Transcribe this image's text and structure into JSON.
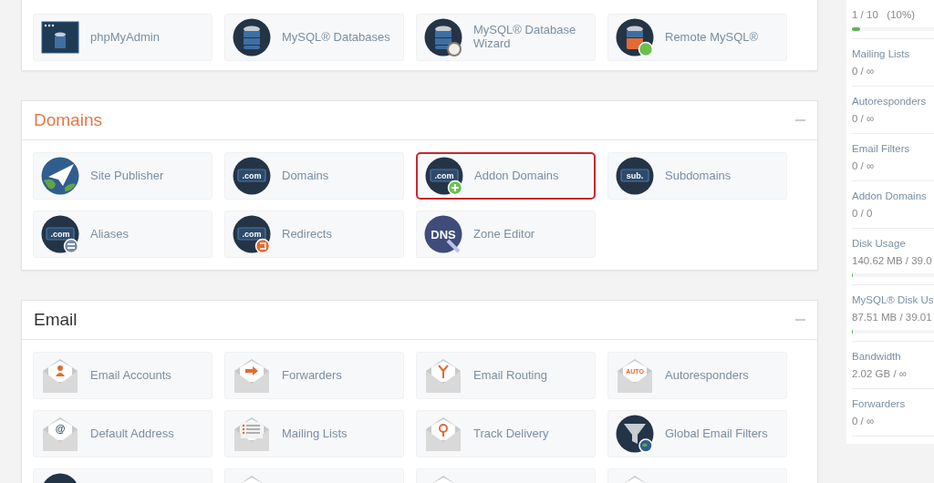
{
  "top_panel": {
    "items": [
      {
        "label": "phpMyAdmin",
        "kind": "db-window",
        "highlighted": false
      },
      {
        "label": "MySQL® Databases",
        "kind": "db",
        "highlighted": false
      },
      {
        "label": "MySQL® Database Wizard",
        "kind": "db-wizard",
        "highlighted": false
      },
      {
        "label": "Remote MySQL®",
        "kind": "db-remote",
        "highlighted": false
      }
    ]
  },
  "sections": [
    {
      "title": "Domains",
      "accent": true,
      "items": [
        {
          "label": "Site Publisher",
          "kind": "globe-plane",
          "highlighted": false
        },
        {
          "label": "Domains",
          "kind": "com",
          "icon_text": ".com",
          "highlighted": false
        },
        {
          "label": "Addon Domains",
          "kind": "com-plus",
          "icon_text": ".com",
          "highlighted": true
        },
        {
          "label": "Subdomains",
          "kind": "com",
          "icon_text": "sub.",
          "highlighted": false
        },
        {
          "label": "Aliases",
          "kind": "com-equal",
          "icon_text": ".com",
          "highlighted": false
        },
        {
          "label": "Redirects",
          "kind": "com-redirect",
          "icon_text": ".com",
          "highlighted": false
        },
        {
          "label": "Zone Editor",
          "kind": "dns",
          "icon_text": "DNS",
          "highlighted": false
        }
      ]
    },
    {
      "title": "Email",
      "accent": false,
      "items": [
        {
          "label": "Email Accounts",
          "kind": "env-person",
          "highlighted": false
        },
        {
          "label": "Forwarders",
          "kind": "env-arrow",
          "highlighted": false
        },
        {
          "label": "Email Routing",
          "kind": "env-fork",
          "highlighted": false
        },
        {
          "label": "Autoresponders",
          "kind": "env-text",
          "icon_text": "AUTO",
          "highlighted": false
        },
        {
          "label": "Default Address",
          "kind": "env-text",
          "icon_text": "@",
          "highlighted": false
        },
        {
          "label": "Mailing Lists",
          "kind": "env-list",
          "highlighted": false
        },
        {
          "label": "Track Delivery",
          "kind": "env-pin",
          "highlighted": false
        },
        {
          "label": "Global Email Filters",
          "kind": "funnel",
          "highlighted": false
        },
        {
          "kind": "circle",
          "highlighted": false
        },
        {
          "kind": "env",
          "highlighted": false
        },
        {
          "kind": "env",
          "highlighted": false
        },
        {
          "kind": "env",
          "highlighted": false
        }
      ]
    }
  ],
  "stats": [
    {
      "value": "1 / 10   (10%)",
      "level": 0.1
    },
    {
      "label": "Mailing Lists",
      "value": "0 / ∞"
    },
    {
      "label": "Autoresponders",
      "value": "0 / ∞"
    },
    {
      "label": "Email Filters",
      "value": "0 / ∞"
    },
    {
      "label": "Addon Domains",
      "value": "0 / 0"
    },
    {
      "label": "Disk Usage",
      "value": "140.62 MB / 39.0",
      "level": 0.01
    },
    {
      "label": "MySQL® Disk Us",
      "value": "87.51 MB / 39.01",
      "level": 0.01
    },
    {
      "label": "Bandwidth",
      "value": "2.02 GB / ∞"
    },
    {
      "label": "Forwarders",
      "value": "0 / ∞"
    }
  ]
}
